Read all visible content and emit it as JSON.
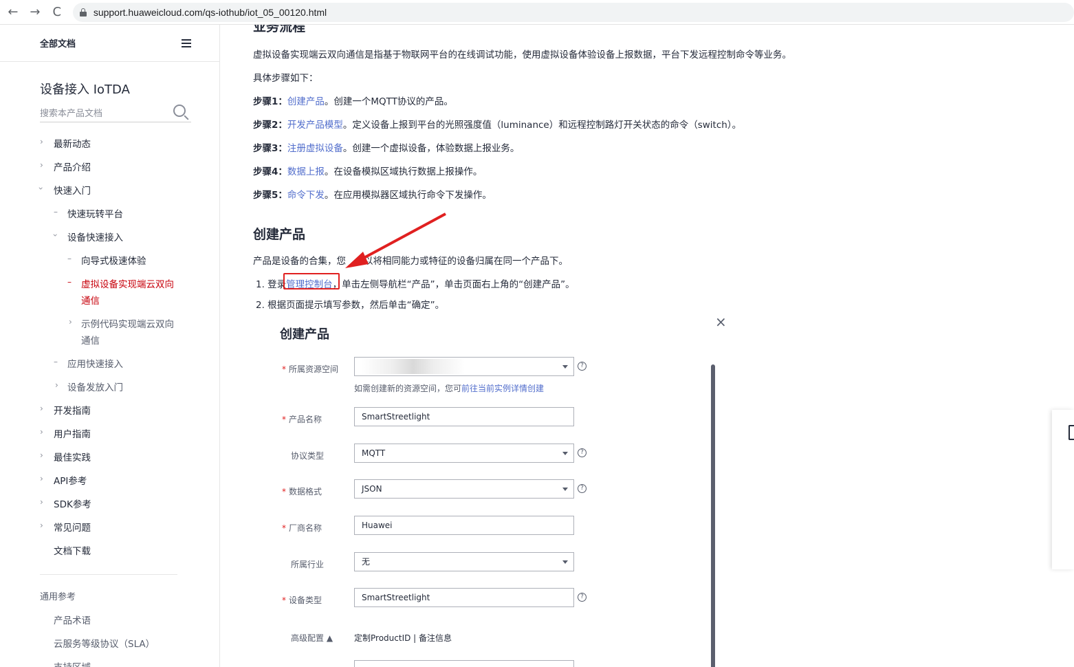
{
  "browser": {
    "url": "support.huaweicloud.com/qs-iothub/iot_05_00120.html",
    "back_icon": "←",
    "forward_icon": "→",
    "reload_icon": "C"
  },
  "sidebar": {
    "all_docs": "全部文档",
    "product_title": "设备接入 IoTDA",
    "search_placeholder": "搜索本产品文档",
    "items": [
      {
        "label": "最新动态"
      },
      {
        "label": "产品介绍"
      },
      {
        "label": "快速入门"
      },
      {
        "label": "快速玩转平台"
      },
      {
        "label": "设备快速接入"
      },
      {
        "label": "向导式极速体验"
      },
      {
        "label": "虚拟设备实现端云双向"
      },
      {
        "label": "通信"
      },
      {
        "label": "示例代码实现端云双向"
      },
      {
        "label": "通信"
      },
      {
        "label": "应用快速接入"
      },
      {
        "label": "设备发放入门"
      },
      {
        "label": "开发指南"
      },
      {
        "label": "用户指南"
      },
      {
        "label": "最佳实践"
      },
      {
        "label": "API参考"
      },
      {
        "label": "SDK参考"
      },
      {
        "label": "常见问题"
      },
      {
        "label": "文档下载"
      }
    ],
    "general_ref": "通用参考",
    "ref_items": [
      {
        "label": "产品术语"
      },
      {
        "label": "云服务等级协议（SLA）"
      },
      {
        "label": "支持区域"
      }
    ]
  },
  "main": {
    "top_heading": "业务流程",
    "intro": "虚拟设备实现端云双向通信是指基于物联网平台的在线调试功能，使用虚拟设备体验设备上报数据，平台下发远程控制命令等业务。",
    "steps_intro": "具体步骤如下：",
    "steps": [
      {
        "label": "步骤1：",
        "link": "创建产品",
        "text": "。创建一个MQTT协议的产品。"
      },
      {
        "label": "步骤2：",
        "link": "开发产品模型",
        "text": "。定义设备上报到平台的光照强度值（luminance）和远程控制路灯开关状态的命令（switch）。"
      },
      {
        "label": "步骤3：",
        "link": "注册虚拟设备",
        "text": "。创建一个虚拟设备，体验数据上报业务。"
      },
      {
        "label": "步骤4：",
        "link": "数据上报",
        "text": "。在设备模拟区域执行数据上报操作。"
      },
      {
        "label": "步骤5：",
        "link": "命令下发",
        "text": "。在应用模拟器区域执行命令下发操作。"
      }
    ],
    "section_title": "创建产品",
    "section_desc_a": "产品是设备的合集，您",
    "section_desc_b": "以将相同能力或特征的设备归属在同一个产品下。",
    "instr1_num": "1. 登录",
    "instr1_link": "管理控制台",
    "instr1_text": "，单击左侧导航栏“产品”，单击页面右上角的“创建产品”。",
    "instr2": "2. 根据页面提示填写参数，然后单击“确定”。"
  },
  "dialog": {
    "title": "创建产品",
    "close_icon": "×",
    "fields": [
      {
        "label": "所属资源空间",
        "required": true,
        "value": "",
        "type": "select"
      },
      {
        "label": "产品名称",
        "required": true,
        "value": "SmartStreetlight",
        "type": "input"
      },
      {
        "label": "协议类型",
        "required": false,
        "value": "MQTT",
        "type": "select"
      },
      {
        "label": "数据格式",
        "required": true,
        "value": "JSON",
        "type": "select"
      },
      {
        "label": "厂商名称",
        "required": true,
        "value": "Huawei",
        "type": "input"
      },
      {
        "label": "所属行业",
        "required": false,
        "value": "无",
        "type": "select"
      },
      {
        "label": "设备类型",
        "required": true,
        "value": "SmartStreetlight",
        "type": "input"
      }
    ],
    "hint_text": "如需创建新的资源空间，您可",
    "hint_link": "前往当前实例详情创建",
    "advanced_label": "高级配置 ▲",
    "advanced_options": "定制ProductID | 备注信息",
    "required_mark": "*",
    "help_mark": "?"
  }
}
